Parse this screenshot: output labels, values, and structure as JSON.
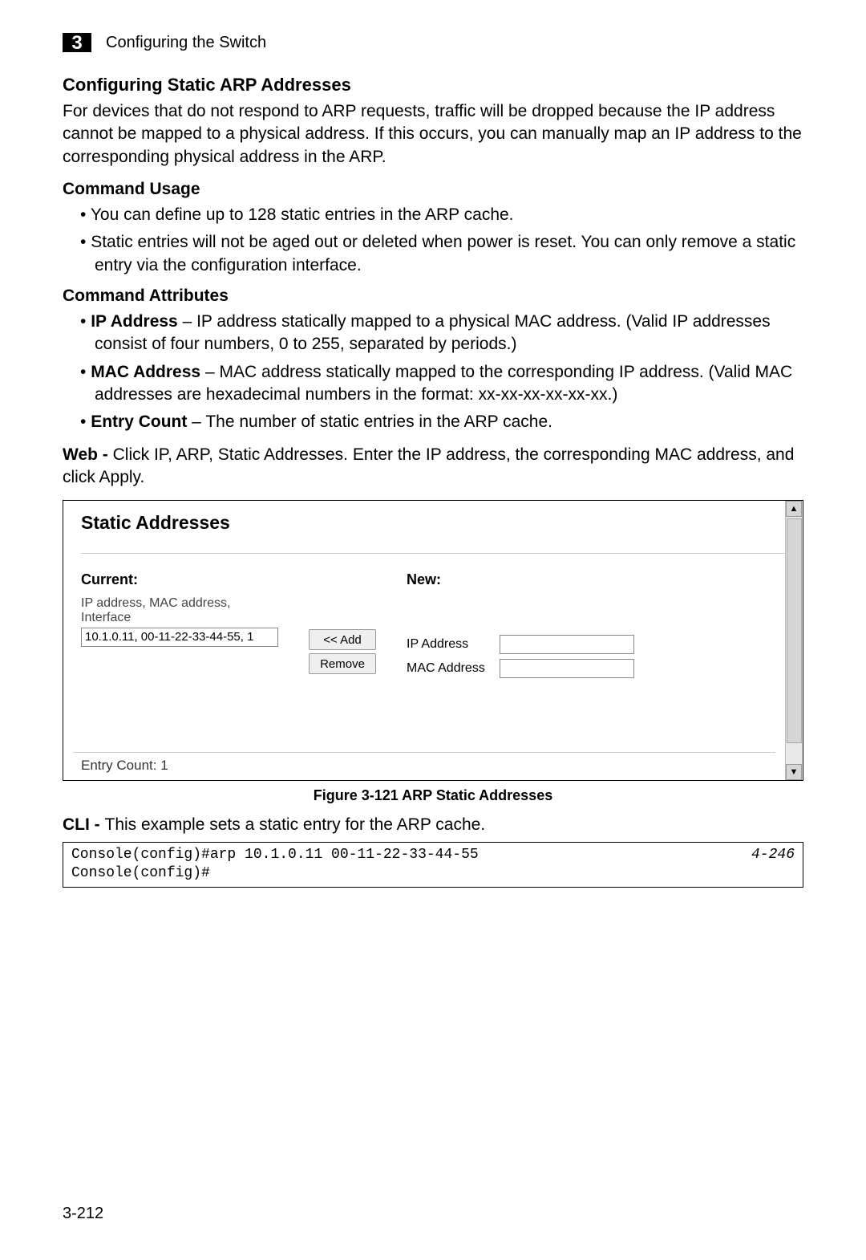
{
  "header": {
    "chapter_number": "3",
    "chapter_title": "Configuring the Switch"
  },
  "section": {
    "title": "Configuring Static ARP Addresses",
    "intro": "For devices that do not respond to ARP requests, traffic will be dropped because the IP address cannot be mapped to a physical address. If this occurs, you can manually map an IP address to the corresponding physical address in the ARP."
  },
  "command_usage": {
    "heading": "Command Usage",
    "items": [
      "You can define up to 128 static entries in the ARP cache.",
      "Static entries will not be aged out or deleted when power is reset. You can only remove a static entry via the configuration interface."
    ]
  },
  "command_attributes": {
    "heading": "Command Attributes",
    "items": [
      {
        "name": "IP Address",
        "desc": " – IP address statically mapped to a physical MAC address. (Valid IP addresses consist of four numbers, 0 to 255, separated by periods.)"
      },
      {
        "name": "MAC Address",
        "desc": " – MAC address statically mapped to the corresponding IP address. (Valid MAC addresses are hexadecimal numbers in the format: xx-xx-xx-xx-xx-xx.)"
      },
      {
        "name": "Entry Count",
        "desc": " – The number of static entries in the ARP cache."
      }
    ]
  },
  "web_instructions": {
    "prefix": "Web - ",
    "text": "Click IP, ARP, Static Addresses. Enter the IP address, the corresponding MAC address, and click Apply."
  },
  "ui_panel": {
    "title": "Static Addresses",
    "current_label": "Current:",
    "current_hint": "IP address, MAC address, Interface",
    "current_entry": "10.1.0.11, 00-11-22-33-44-55, 1",
    "new_label": "New:",
    "add_button": "<< Add",
    "remove_button": "Remove",
    "ip_label": "IP Address",
    "mac_label": "MAC Address",
    "ip_value": "",
    "mac_value": "",
    "entry_count": "Entry Count: 1"
  },
  "figure_caption": "Figure 3-121   ARP Static Addresses",
  "cli": {
    "prefix": "CLI - ",
    "text": "This example sets a static entry for the ARP cache.",
    "code_left": "Console(config)#arp 10.1.0.11 00-11-22-33-44-55\nConsole(config)#",
    "code_right": "4-246"
  },
  "page_number": "3-212"
}
